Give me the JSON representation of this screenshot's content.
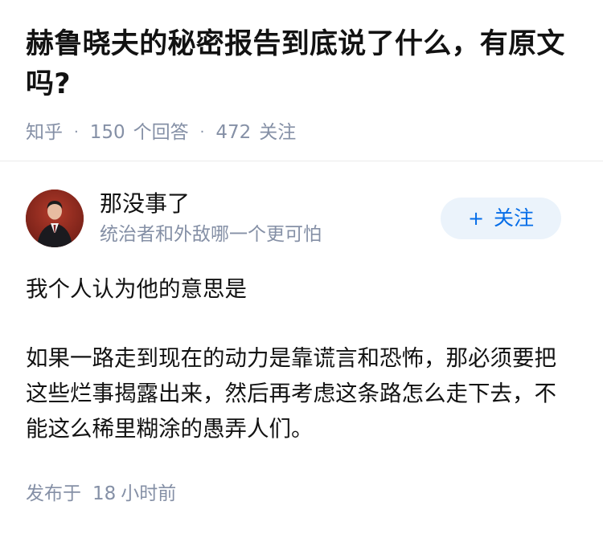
{
  "question": {
    "title": "赫鲁晓夫的秘密报告到底说了什么，有原文吗?",
    "source": "知乎",
    "answers_count": "150",
    "answers_label": "个回答",
    "followers_count": "472",
    "followers_label": "关注"
  },
  "author": {
    "name": "那没事了",
    "bio": "统治者和外敌哪一个更可怕",
    "avatar_icon": "avatar-photo",
    "follow_plus": "+",
    "follow_label": "关注"
  },
  "answer": {
    "paragraphs": [
      "我个人认为他的意思是",
      "如果一路走到现在的动力是靠谎言和恐怖，那必须要把这些烂事揭露出来，然后再考虑这条路怎么走下去，不能这么稀里糊涂的愚弄人们。"
    ],
    "published_prefix": "发布于",
    "published_count": "18",
    "published_unit": "小时前"
  },
  "colors": {
    "text": "#121212",
    "meta": "#8590a6",
    "accent": "#056de8",
    "follow_bg": "#ebf3fb"
  }
}
